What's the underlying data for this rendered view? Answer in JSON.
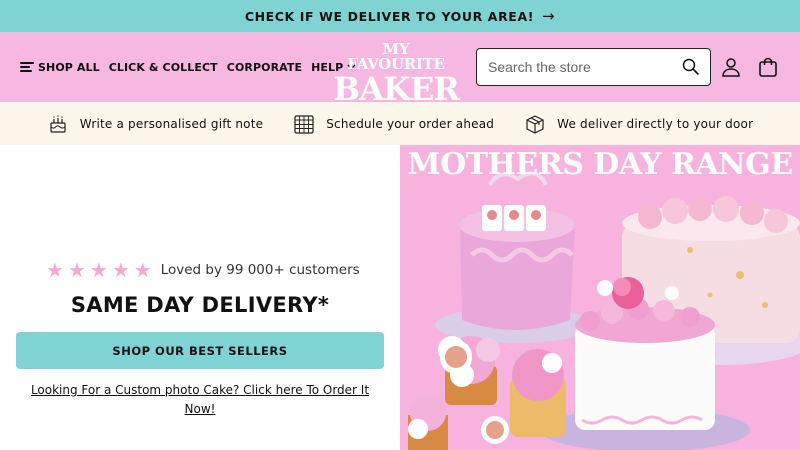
{
  "announcement": {
    "text": "CHECK IF WE DELIVER TO YOUR AREA!",
    "arrow_icon": "arrow-right-icon"
  },
  "nav": {
    "shop_all": "SHOP ALL",
    "click_collect": "CLICK & COLLECT",
    "corporate": "CORPORATE",
    "help": "HELP"
  },
  "logo": {
    "line1": "MY FAVOURITE",
    "line2": "BAKER"
  },
  "search": {
    "placeholder": "Search the store",
    "icon": "search-icon"
  },
  "header_icons": [
    "account-icon",
    "cart-icon"
  ],
  "usp": [
    {
      "icon": "cake-icon",
      "text": "Write a personalised gift note"
    },
    {
      "icon": "calendar-icon",
      "text": "Schedule your order ahead"
    },
    {
      "icon": "box-icon",
      "text": "We deliver directly to your door"
    }
  ],
  "hero": {
    "stars": 5,
    "rating_text": "Loved by 99 000+ customers",
    "headline": "SAME DAY DELIVERY*",
    "cta_label": "SHOP OUR BEST SELLERS",
    "custom_link": "Looking For a Custom photo Cake? Click here To Order It Now!",
    "banner_title": "MOTHERS DAY RANGE"
  },
  "colors": {
    "teal": "#7fd3d3",
    "pink_header": "#f6b7e0",
    "cream": "#fdf6ea",
    "star_pink": "#f4a9d3",
    "banner_pink": "#f7b3dd"
  }
}
